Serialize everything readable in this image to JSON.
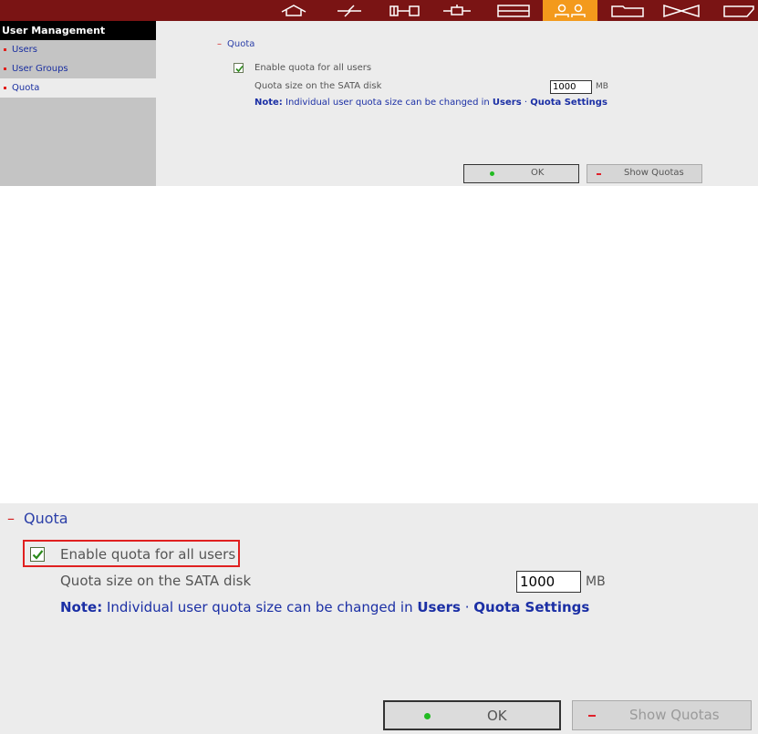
{
  "toolbar": {
    "icons": [
      {
        "name": "home-icon"
      },
      {
        "name": "network-icon"
      },
      {
        "name": "system-icon"
      },
      {
        "name": "device-icon"
      },
      {
        "name": "storage-icon"
      },
      {
        "name": "users-icon",
        "active": true
      },
      {
        "name": "folder-icon"
      },
      {
        "name": "services-icon"
      },
      {
        "name": "logout-icon"
      }
    ],
    "bg_color": "#7a1414",
    "active_color": "#f39a1c"
  },
  "sidebar": {
    "header": "User Management",
    "items": [
      {
        "label": "Users"
      },
      {
        "label": "User Groups"
      },
      {
        "label": "Quota",
        "active": true
      }
    ]
  },
  "quota": {
    "section_title": "Quota",
    "enable_label": "Enable quota for all users",
    "enable_checked": true,
    "size_label": "Quota size on the SATA disk",
    "size_value": "1000",
    "size_unit": "MB",
    "note_prefix": "Note:",
    "note_text": " Individual user quota size can be changed in ",
    "note_link1": "Users",
    "note_sep": " · ",
    "note_link2": "Quota Settings",
    "ok_label": "OK",
    "show_quotas_label": "Show Quotas"
  }
}
